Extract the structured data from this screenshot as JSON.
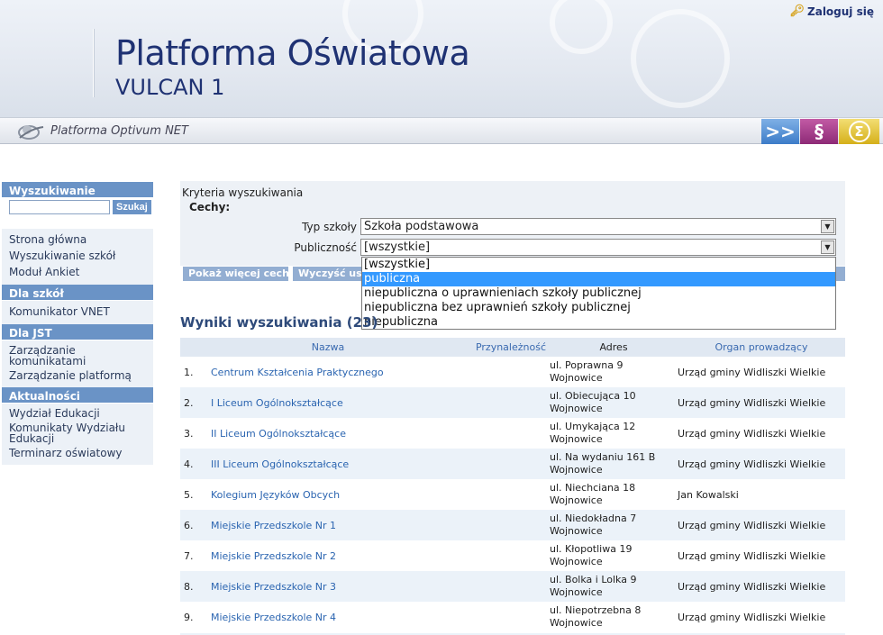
{
  "header": {
    "title": "Platforma Oświatowa",
    "subtitle": "VULCAN 1",
    "login_label": "Zaloguj się"
  },
  "toolbar": {
    "product_label": "Platforma Optivum NET",
    "buttons": [
      {
        "icon": "double-chevron-right-icon",
        "glyph": ">>"
      },
      {
        "icon": "paragraph-icon",
        "glyph": "§"
      },
      {
        "icon": "sigma-icon",
        "glyph": "Σ"
      }
    ]
  },
  "sidebar": {
    "search_heading": "Wyszukiwanie",
    "search_value": "",
    "search_button": "Szukaj",
    "main_links": [
      "Strona główna",
      "Wyszukiwanie szkół",
      "Moduł Ankiet"
    ],
    "schools_heading": "Dla szkół",
    "schools_links": [
      "Komunikator VNET"
    ],
    "jst_heading": "Dla JST",
    "jst_links": [
      "Zarządzanie komunikatami",
      "Zarządzanie platformą"
    ],
    "news_heading": "Aktualności",
    "news_links": [
      "Wydział Edukacji",
      "Komunikaty Wydziału Edukacji",
      "Terminarz oświatowy"
    ]
  },
  "criteria": {
    "title": "Kryteria wyszukiwania",
    "features_label": "Cechy:",
    "school_type_label": "Typ szkoły",
    "school_type_value": "Szkoła podstawowa",
    "public_label": "Publiczność",
    "public_value": "[wszystkie]",
    "more_button": "Pokaż więcej cech",
    "clear_button": "Wyczyść ust",
    "public_options": [
      "[wszystkie]",
      "publiczna",
      "niepubliczna o uprawnieniach szkoły publicznej",
      "niepubliczna bez uprawnień szkoły publicznej",
      "niepubliczna"
    ],
    "highlighted_option": 1
  },
  "results": {
    "title": "Wyniki wyszukiwania (23)",
    "columns": {
      "name": "Nazwa",
      "affiliation": "Przynależność",
      "address": "Adres",
      "authority": "Organ prowadzący"
    },
    "rows": [
      {
        "num": "1.",
        "name": "Centrum Kształcenia Praktycznego",
        "street": "ul. Poprawna 9",
        "city": "Wojnowice",
        "org": "Urząd gminy Widliszki Wielkie"
      },
      {
        "num": "2.",
        "name": "I Liceum Ogólnokształcące",
        "street": "ul. Obiecująca 10",
        "city": "Wojnowice",
        "org": "Urząd gminy Widliszki Wielkie"
      },
      {
        "num": "3.",
        "name": "II Liceum Ogólnokształcące",
        "street": "ul. Umykająca 12",
        "city": "Wojnowice",
        "org": "Urząd gminy Widliszki Wielkie"
      },
      {
        "num": "4.",
        "name": "III Liceum Ogólnokształcące",
        "street": "ul. Na wydaniu 161 B",
        "city": "Wojnowice",
        "org": "Urząd gminy Widliszki Wielkie"
      },
      {
        "num": "5.",
        "name": "Kolegium Języków Obcych",
        "street": "ul. Niechciana 18",
        "city": "Wojnowice",
        "org": "Jan Kowalski"
      },
      {
        "num": "6.",
        "name": "Miejskie Przedszkole Nr 1",
        "street": "ul. Niedokładna 7",
        "city": "Wojnowice",
        "org": "Urząd gminy Widliszki Wielkie"
      },
      {
        "num": "7.",
        "name": "Miejskie Przedszkole Nr 2",
        "street": "ul. Kłopotliwa 19",
        "city": "Wojnowice",
        "org": "Urząd gminy Widliszki Wielkie"
      },
      {
        "num": "8.",
        "name": "Miejskie Przedszkole Nr 3",
        "street": "ul. Bolka i Lolka 9",
        "city": "Wojnowice",
        "org": "Urząd gminy Widliszki Wielkie"
      },
      {
        "num": "9.",
        "name": "Miejskie Przedszkole Nr 4",
        "street": "ul. Niepotrzebna 8",
        "city": "Wojnowice",
        "org": "Urząd gminy Widliszki Wielkie"
      }
    ]
  }
}
